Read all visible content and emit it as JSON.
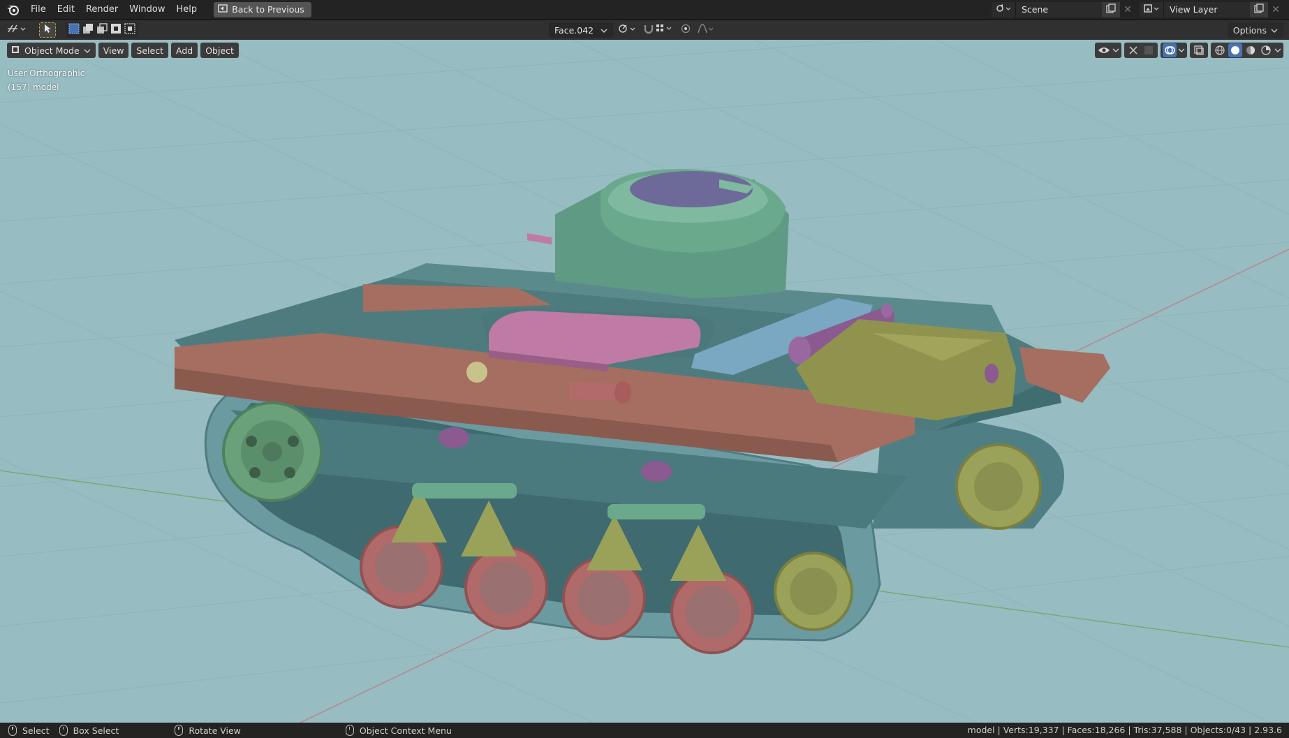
{
  "topbar": {
    "menus": [
      "File",
      "Edit",
      "Render",
      "Window",
      "Help"
    ],
    "back_button": "Back to Previous",
    "scene_label": "Scene",
    "view_layer_label": "View Layer"
  },
  "toolbar": {
    "active_object_dropdown": "Face.042",
    "options_label": "Options"
  },
  "viewport": {
    "mode_label": "Object Mode",
    "menus": [
      "View",
      "Select",
      "Add",
      "Object"
    ],
    "view_name": "User Orthographic",
    "object_info": "(157) model",
    "background_color": "#97bcc2"
  },
  "statusbar": {
    "select": "Select",
    "box_select": "Box Select",
    "rotate_view": "Rotate View",
    "context_menu": "Object Context Menu",
    "stats": "model | Verts:19,337 | Faces:18,266 | Tris:37,588 | Objects:0/43 | 2.93.6"
  },
  "colors": {
    "hull": "#4e7c7e",
    "track": "#6b9aa0",
    "fender": "#a56e60",
    "turret": "#6aa98c",
    "hatch": "#6d6a9a",
    "engine_deck": "#8f934e",
    "pink_hatch": "#c07aa6",
    "wheel": "#b06a6a",
    "bogie": "#9aa25a",
    "sprocket": "#6aa07a"
  }
}
